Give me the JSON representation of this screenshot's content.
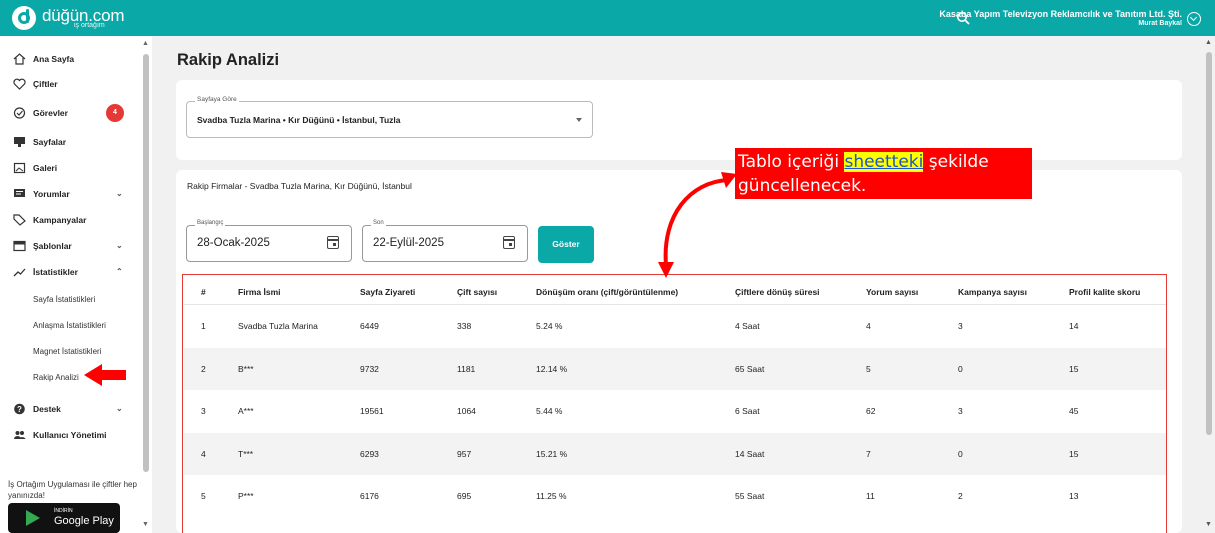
{
  "header": {
    "brand": "düğün.com",
    "brand_sub": "iş ortağım",
    "company": "Kasaba Yapım Televizyon Reklamcılık ve Tanıtım Ltd. Şti.",
    "user": "Murat Baykal",
    "accent_color": "#0ba8a8"
  },
  "sidebar": {
    "items": [
      {
        "label": "Ana Sayfa",
        "icon": "home-icon"
      },
      {
        "label": "Çiftler",
        "icon": "heart-icon"
      },
      {
        "label": "Görevler",
        "icon": "check-circle-icon",
        "badge": "4"
      },
      {
        "label": "Sayfalar",
        "icon": "monitor-icon"
      },
      {
        "label": "Galeri",
        "icon": "gallery-icon"
      },
      {
        "label": "Yorumlar",
        "icon": "comment-icon"
      },
      {
        "label": "Kampanyalar",
        "icon": "tag-icon"
      },
      {
        "label": "Şablonlar",
        "icon": "template-icon"
      },
      {
        "label": "İstatistikler",
        "icon": "trending-icon"
      },
      {
        "label": "Destek",
        "icon": "help-icon"
      },
      {
        "label": "Kullanıcı Yönetimi",
        "icon": "users-icon"
      }
    ],
    "sub_items": [
      "Sayfa İstatistikleri",
      "Anlaşma İstatistikleri",
      "Magnet İstatistikleri",
      "Rakip Analizi"
    ],
    "promo": "İş Ortağım Uygulaması ile çiftler hep yanınızda!",
    "gplay_small": "İNDİRİN",
    "gplay_big": "Google Play"
  },
  "page": {
    "title": "Rakip Analizi",
    "select_legend": "Sayfaya Göre",
    "select_value": "Svadba Tuzla Marina  •  Kır Düğünü  •  İstanbul, Tuzla",
    "rakip_title": "Rakip Firmalar - Svadba Tuzla Marina, Kır Düğünü, İstanbul",
    "start_legend": "Başlangıç",
    "start_value": "28-Ocak-2025",
    "end_legend": "Son",
    "end_value": "22-Eylül-2025",
    "show_button": "Göster"
  },
  "annotation": {
    "text_before": "Tablo içeriği ",
    "highlight": "sheetteki",
    "text_after": " şekilde güncellenecek."
  },
  "table": {
    "headers": [
      "#",
      "Firma İsmi",
      "Sayfa Ziyareti",
      "Çift sayısı",
      "Dönüşüm oranı (çift/görüntülenme)",
      "Çiftlere dönüş süresi",
      "Yorum sayısı",
      "Kampanya sayısı",
      "Profil kalite skoru"
    ],
    "rows": [
      [
        "1",
        "Svadba Tuzla Marina",
        "6449",
        "338",
        "5.24 %",
        "4 Saat",
        "4",
        "3",
        "14"
      ],
      [
        "2",
        "B***",
        "9732",
        "1181",
        "12.14 %",
        "65 Saat",
        "5",
        "0",
        "15"
      ],
      [
        "3",
        "A***",
        "19561",
        "1064",
        "5.44 %",
        "6 Saat",
        "62",
        "3",
        "45"
      ],
      [
        "4",
        "T***",
        "6293",
        "957",
        "15.21 %",
        "14 Saat",
        "7",
        "0",
        "15"
      ],
      [
        "5",
        "P***",
        "6176",
        "695",
        "11.25 %",
        "55 Saat",
        "11",
        "2",
        "13"
      ]
    ]
  }
}
